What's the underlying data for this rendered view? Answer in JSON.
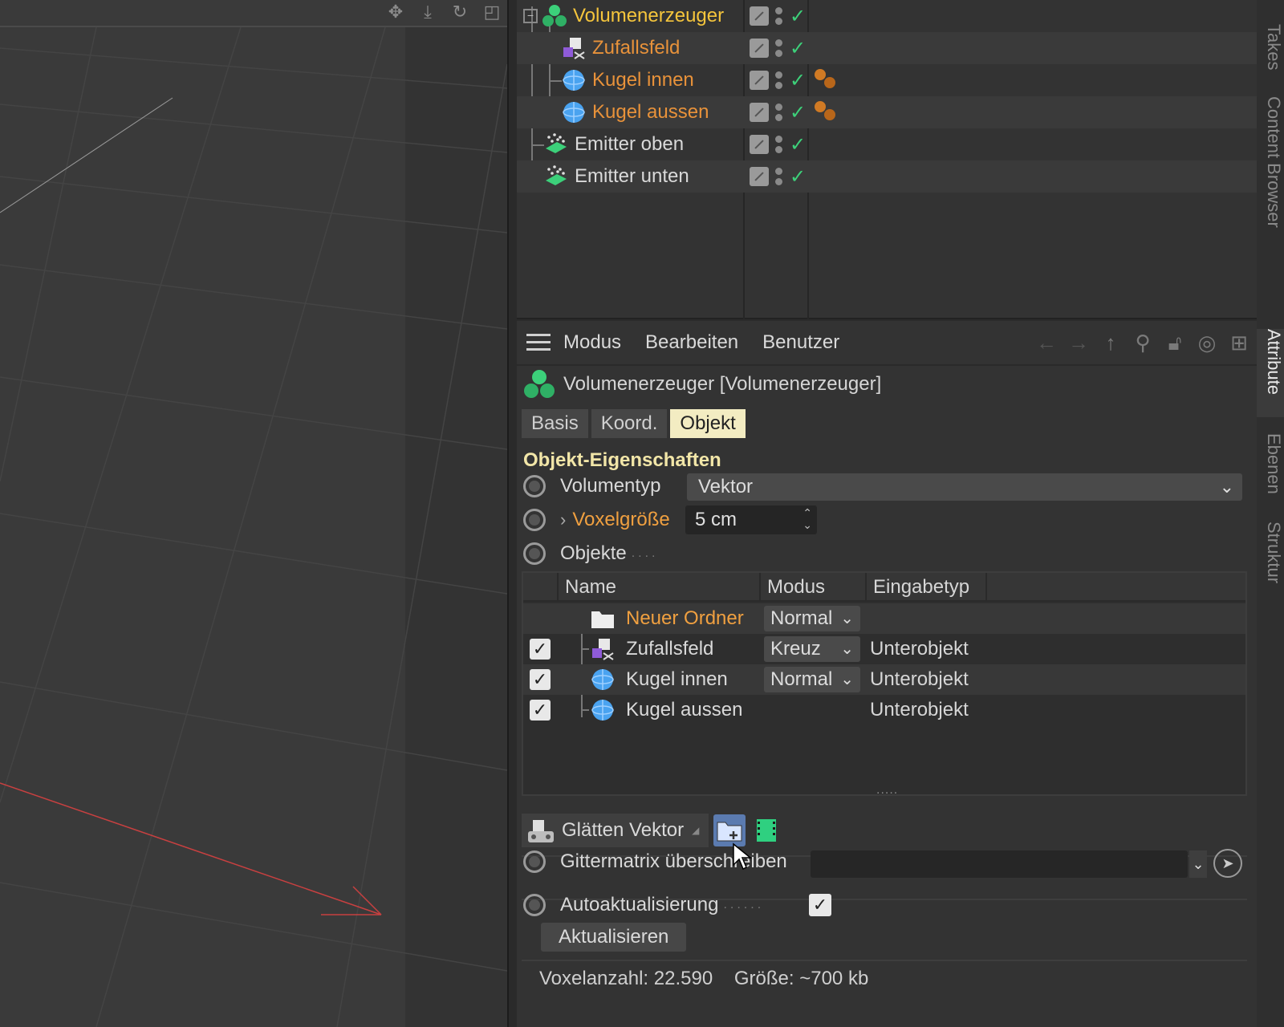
{
  "viewport": {
    "toolbar_icons": [
      "move-icon",
      "drop-icon",
      "rotate-icon",
      "maximize-icon"
    ]
  },
  "object_manager": {
    "objects": [
      {
        "name": "Volumenerzeuger",
        "icon": "volume-builder-icon",
        "style": "selected"
      },
      {
        "name": "Zufallsfeld",
        "icon": "random-field-icon",
        "style": "child"
      },
      {
        "name": "Kugel innen",
        "icon": "sphere-icon",
        "style": "child",
        "tag": "material-balls-icon"
      },
      {
        "name": "Kugel aussen",
        "icon": "sphere-icon",
        "style": "child",
        "tag": "material-balls-icon"
      },
      {
        "name": "Emitter oben",
        "icon": "emitter-icon",
        "style": "normal"
      },
      {
        "name": "Emitter unten",
        "icon": "emitter-icon",
        "style": "normal"
      }
    ]
  },
  "side_tabs": {
    "takes": "Takes",
    "content_browser": "Content Browser",
    "attribute": "Attribute",
    "ebenen": "Ebenen",
    "struktur": "Struktur"
  },
  "attributes": {
    "menu": {
      "modus": "Modus",
      "bearbeiten": "Bearbeiten",
      "benutzer": "Benutzer"
    },
    "object_title": "Volumenerzeuger [Volumenerzeuger]",
    "tabs": {
      "basis": "Basis",
      "koord": "Koord.",
      "objekt": "Objekt"
    },
    "section_title": "Objekt-Eigenschaften",
    "volumentyp": {
      "label": "Volumentyp",
      "value": "Vektor"
    },
    "voxelgroesse": {
      "label": "Voxelgröße",
      "value": "5 cm"
    },
    "objekte_label": "Objekte",
    "list": {
      "headers": {
        "name": "Name",
        "modus": "Modus",
        "eingabetyp": "Eingabetyp"
      },
      "rows": [
        {
          "name": "Neuer Ordner",
          "mode": "Normal",
          "input": "",
          "checked": false
        },
        {
          "name": "Zufallsfeld",
          "mode": "Kreuz",
          "input": "Unterobjekt",
          "checked": true
        },
        {
          "name": "Kugel innen",
          "mode": "Normal",
          "input": "Unterobjekt",
          "checked": true
        },
        {
          "name": "Kugel aussen",
          "mode": "",
          "input": "Unterobjekt",
          "checked": true
        }
      ]
    },
    "filter_button": "Glätten Vektor",
    "gittermatrix_label": "Gittermatrix überschreiben",
    "autoaktualisierung_label": "Autoaktualisierung",
    "aktualisieren_button": "Aktualisieren",
    "status": {
      "voxelanzahl": "Voxelanzahl: 22.590",
      "groesse": "Größe: ~700 kb"
    }
  },
  "colors": {
    "selected_name": "#f5c53c",
    "child_name": "#e8923a",
    "active_tab": "#f3ecc2",
    "section_title": "#f2e6a8",
    "check_green": "#3dd17a"
  }
}
